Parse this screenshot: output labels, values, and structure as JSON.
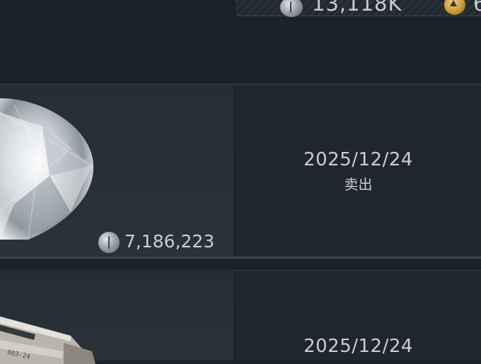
{
  "header": {
    "silver_balance": "13,118K",
    "gold_balance_partial": "6"
  },
  "transactions": [
    {
      "item": "diamond",
      "price": "7,186,223",
      "date": "2025/12/24",
      "action": "卖出"
    },
    {
      "item": "weapon-case",
      "price": "",
      "date": "2025/12/24",
      "action": ""
    }
  ],
  "colors": {
    "background": "#1b2229",
    "cell_item": "#262e35",
    "cell_date": "#1f262d",
    "text": "#c9ced3"
  }
}
